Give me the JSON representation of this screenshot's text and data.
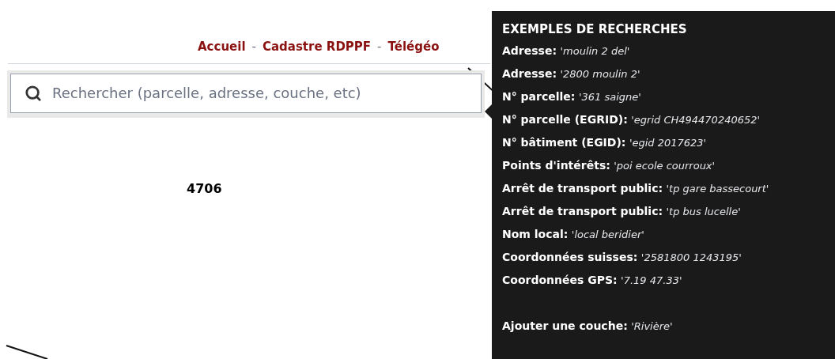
{
  "nav": {
    "links": [
      "Accueil",
      "Cadastre RDPPF",
      "Télégéo"
    ],
    "separator": "-"
  },
  "search": {
    "placeholder": "Rechercher (parcelle, adresse, couche, etc)"
  },
  "map": {
    "labels": [
      "4706"
    ]
  },
  "tooltip": {
    "title": "EXEMPLES DE RECHERCHES",
    "examples": [
      {
        "label": "Adresse:",
        "value": "'moulin 2 del'"
      },
      {
        "label": "Adresse:",
        "value": "'2800 moulin 2'"
      },
      {
        "label": "N° parcelle:",
        "value": "'361 saigne'"
      },
      {
        "label": "N° parcelle (EGRID):",
        "value": "'egrid CH494470240652'"
      },
      {
        "label": "N° bâtiment (EGID):",
        "value": "'egid 2017623'"
      },
      {
        "label": "Points d'intérêts:",
        "value": "'poi ecole courroux'"
      },
      {
        "label": "Arrêt de transport public:",
        "value": "'tp gare bassecourt'"
      },
      {
        "label": "Arrêt de transport public:",
        "value": "'tp bus lucelle'"
      },
      {
        "label": "Nom local:",
        "value": "'local beridier'"
      },
      {
        "label": "Coordonnées suisses:",
        "value": "'2581800 1243195'"
      },
      {
        "label": "Coordonnées GPS:",
        "value": "'7.19 47.33'"
      }
    ],
    "extra": [
      {
        "label": "Ajouter une couche:",
        "value": "'Rivière'"
      }
    ]
  }
}
